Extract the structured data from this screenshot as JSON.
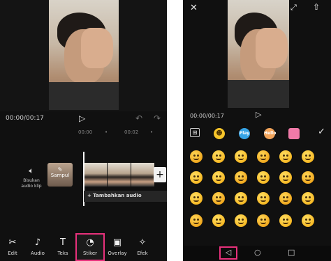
{
  "left": {
    "time": "00:00/00:17",
    "ruler": [
      "00:00",
      "•",
      "00:02",
      "•"
    ],
    "mute_label": "Bisukan audio klip",
    "cover_label": "Sampul",
    "audio_label": "+ Tambahkan audio",
    "add_clip": "+",
    "tools": [
      {
        "label": "Edit",
        "icon": "scissors-icon"
      },
      {
        "label": "Audio",
        "icon": "music-note-icon"
      },
      {
        "label": "Teks",
        "icon": "text-icon"
      },
      {
        "label": "Stiker",
        "icon": "sticker-icon"
      },
      {
        "label": "Overlay",
        "icon": "overlay-icon"
      },
      {
        "label": "Efek",
        "icon": "effects-icon"
      }
    ],
    "active_tool": "Stiker"
  },
  "right": {
    "time": "00:00/00:17",
    "sticker_tabs": [
      "Play",
      "Hello"
    ]
  },
  "colors": {
    "background": "#101010",
    "highlight": "#e8317c",
    "emoji": "#f7b924"
  }
}
